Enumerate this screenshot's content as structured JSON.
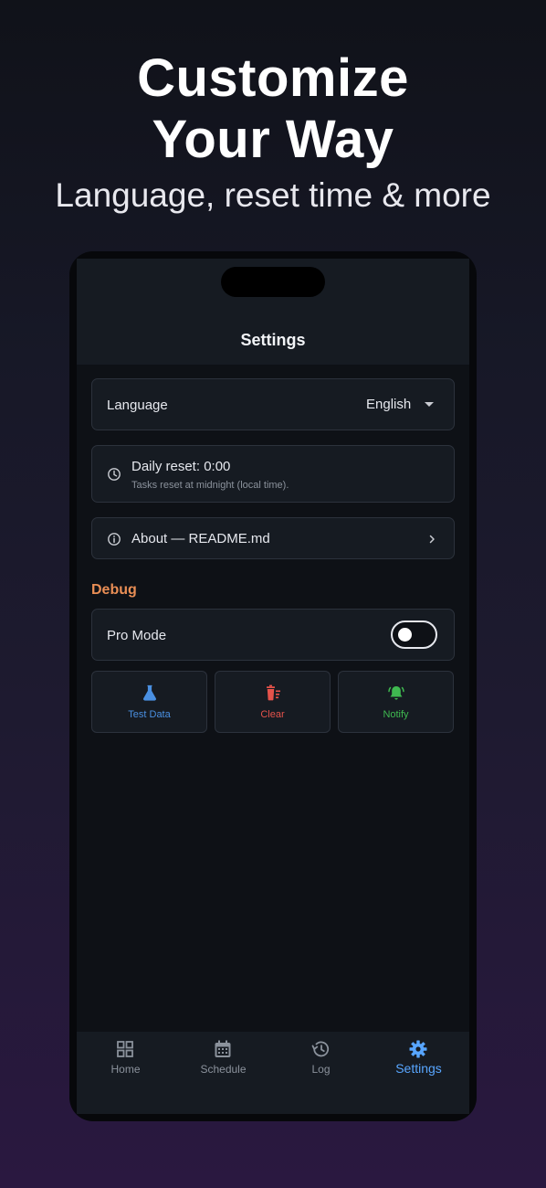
{
  "hero": {
    "title_line1": "Customize",
    "title_line2": "Your Way",
    "subtitle": "Language, reset time & more"
  },
  "app": {
    "title": "Settings"
  },
  "language": {
    "label": "Language",
    "value": "English"
  },
  "reset": {
    "title": "Daily reset: 0:00",
    "subtitle": "Tasks reset at midnight (local time)."
  },
  "about": {
    "label": "About — README.md"
  },
  "debug": {
    "section_title": "Debug",
    "pro_mode_label": "Pro Mode",
    "pro_mode_on": false,
    "buttons": [
      {
        "label": "Test Data",
        "icon": "flask-icon",
        "color": "#4a90e2"
      },
      {
        "label": "Clear",
        "icon": "trash-icon",
        "color": "#e5534b"
      },
      {
        "label": "Notify",
        "icon": "bell-icon",
        "color": "#3fb950"
      }
    ]
  },
  "nav": {
    "items": [
      {
        "label": "Home",
        "icon": "grid-icon",
        "active": false
      },
      {
        "label": "Schedule",
        "icon": "calendar-icon",
        "active": false
      },
      {
        "label": "Log",
        "icon": "history-icon",
        "active": false
      },
      {
        "label": "Settings",
        "icon": "gear-icon",
        "active": true
      }
    ],
    "active_color": "#58a6ff",
    "inactive_color": "#8b929c"
  },
  "colors": {
    "accent_debug": "#e98e55",
    "card_bg": "#161b22",
    "screen_bg": "#0e1116"
  }
}
